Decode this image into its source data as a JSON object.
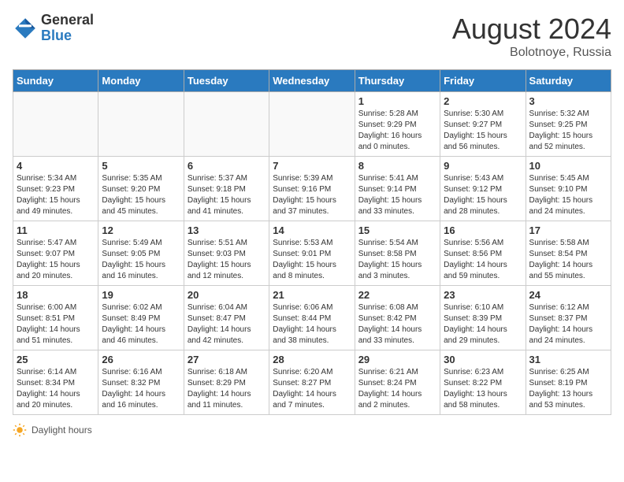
{
  "header": {
    "logo_general": "General",
    "logo_blue": "Blue",
    "month_year": "August 2024",
    "location": "Bolotnoye, Russia"
  },
  "days_of_week": [
    "Sunday",
    "Monday",
    "Tuesday",
    "Wednesday",
    "Thursday",
    "Friday",
    "Saturday"
  ],
  "weeks": [
    [
      {
        "day": "",
        "info": ""
      },
      {
        "day": "",
        "info": ""
      },
      {
        "day": "",
        "info": ""
      },
      {
        "day": "",
        "info": ""
      },
      {
        "day": "1",
        "info": "Sunrise: 5:28 AM\nSunset: 9:29 PM\nDaylight: 16 hours\nand 0 minutes."
      },
      {
        "day": "2",
        "info": "Sunrise: 5:30 AM\nSunset: 9:27 PM\nDaylight: 15 hours\nand 56 minutes."
      },
      {
        "day": "3",
        "info": "Sunrise: 5:32 AM\nSunset: 9:25 PM\nDaylight: 15 hours\nand 52 minutes."
      }
    ],
    [
      {
        "day": "4",
        "info": "Sunrise: 5:34 AM\nSunset: 9:23 PM\nDaylight: 15 hours\nand 49 minutes."
      },
      {
        "day": "5",
        "info": "Sunrise: 5:35 AM\nSunset: 9:20 PM\nDaylight: 15 hours\nand 45 minutes."
      },
      {
        "day": "6",
        "info": "Sunrise: 5:37 AM\nSunset: 9:18 PM\nDaylight: 15 hours\nand 41 minutes."
      },
      {
        "day": "7",
        "info": "Sunrise: 5:39 AM\nSunset: 9:16 PM\nDaylight: 15 hours\nand 37 minutes."
      },
      {
        "day": "8",
        "info": "Sunrise: 5:41 AM\nSunset: 9:14 PM\nDaylight: 15 hours\nand 33 minutes."
      },
      {
        "day": "9",
        "info": "Sunrise: 5:43 AM\nSunset: 9:12 PM\nDaylight: 15 hours\nand 28 minutes."
      },
      {
        "day": "10",
        "info": "Sunrise: 5:45 AM\nSunset: 9:10 PM\nDaylight: 15 hours\nand 24 minutes."
      }
    ],
    [
      {
        "day": "11",
        "info": "Sunrise: 5:47 AM\nSunset: 9:07 PM\nDaylight: 15 hours\nand 20 minutes."
      },
      {
        "day": "12",
        "info": "Sunrise: 5:49 AM\nSunset: 9:05 PM\nDaylight: 15 hours\nand 16 minutes."
      },
      {
        "day": "13",
        "info": "Sunrise: 5:51 AM\nSunset: 9:03 PM\nDaylight: 15 hours\nand 12 minutes."
      },
      {
        "day": "14",
        "info": "Sunrise: 5:53 AM\nSunset: 9:01 PM\nDaylight: 15 hours\nand 8 minutes."
      },
      {
        "day": "15",
        "info": "Sunrise: 5:54 AM\nSunset: 8:58 PM\nDaylight: 15 hours\nand 3 minutes."
      },
      {
        "day": "16",
        "info": "Sunrise: 5:56 AM\nSunset: 8:56 PM\nDaylight: 14 hours\nand 59 minutes."
      },
      {
        "day": "17",
        "info": "Sunrise: 5:58 AM\nSunset: 8:54 PM\nDaylight: 14 hours\nand 55 minutes."
      }
    ],
    [
      {
        "day": "18",
        "info": "Sunrise: 6:00 AM\nSunset: 8:51 PM\nDaylight: 14 hours\nand 51 minutes."
      },
      {
        "day": "19",
        "info": "Sunrise: 6:02 AM\nSunset: 8:49 PM\nDaylight: 14 hours\nand 46 minutes."
      },
      {
        "day": "20",
        "info": "Sunrise: 6:04 AM\nSunset: 8:47 PM\nDaylight: 14 hours\nand 42 minutes."
      },
      {
        "day": "21",
        "info": "Sunrise: 6:06 AM\nSunset: 8:44 PM\nDaylight: 14 hours\nand 38 minutes."
      },
      {
        "day": "22",
        "info": "Sunrise: 6:08 AM\nSunset: 8:42 PM\nDaylight: 14 hours\nand 33 minutes."
      },
      {
        "day": "23",
        "info": "Sunrise: 6:10 AM\nSunset: 8:39 PM\nDaylight: 14 hours\nand 29 minutes."
      },
      {
        "day": "24",
        "info": "Sunrise: 6:12 AM\nSunset: 8:37 PM\nDaylight: 14 hours\nand 24 minutes."
      }
    ],
    [
      {
        "day": "25",
        "info": "Sunrise: 6:14 AM\nSunset: 8:34 PM\nDaylight: 14 hours\nand 20 minutes."
      },
      {
        "day": "26",
        "info": "Sunrise: 6:16 AM\nSunset: 8:32 PM\nDaylight: 14 hours\nand 16 minutes."
      },
      {
        "day": "27",
        "info": "Sunrise: 6:18 AM\nSunset: 8:29 PM\nDaylight: 14 hours\nand 11 minutes."
      },
      {
        "day": "28",
        "info": "Sunrise: 6:20 AM\nSunset: 8:27 PM\nDaylight: 14 hours\nand 7 minutes."
      },
      {
        "day": "29",
        "info": "Sunrise: 6:21 AM\nSunset: 8:24 PM\nDaylight: 14 hours\nand 2 minutes."
      },
      {
        "day": "30",
        "info": "Sunrise: 6:23 AM\nSunset: 8:22 PM\nDaylight: 13 hours\nand 58 minutes."
      },
      {
        "day": "31",
        "info": "Sunrise: 6:25 AM\nSunset: 8:19 PM\nDaylight: 13 hours\nand 53 minutes."
      }
    ]
  ],
  "footer": {
    "daylight_label": "Daylight hours"
  }
}
